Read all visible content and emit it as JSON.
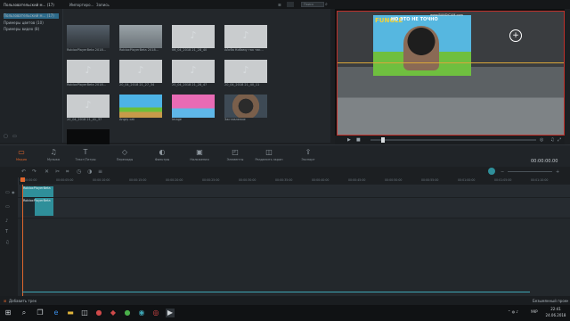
{
  "top": {
    "project_menu": "Пользовательский м... (17)",
    "import_label": "Импортиро...",
    "export_label": "Запись",
    "search_placeholder": "Поиск"
  },
  "library": {
    "items": [
      {
        "label": "Пользовательский м... (17)"
      },
      {
        "label": "Примеры цветов (10)"
      },
      {
        "label": "Примеры видео (8)"
      }
    ]
  },
  "media": {
    "items": [
      {
        "label": "RobloxPlayerBeta 2018...",
        "kind": "video-dark"
      },
      {
        "label": "RobloxPlayerBeta 2018...",
        "kind": "video-gray"
      },
      {
        "label": "06_04_2018 21_28_40",
        "kind": "audio"
      },
      {
        "label": "Айсба Кобаму так так...",
        "kind": "audio"
      },
      {
        "label": "RobloxPlayerBeta 2018...",
        "kind": "audio"
      },
      {
        "label": "20_04_2018 21_27_34",
        "kind": "audio"
      },
      {
        "label": "20_04_2018 21_28_47",
        "kind": "audio"
      },
      {
        "label": "20_04_2018 21_40_11",
        "kind": "audio"
      },
      {
        "label": "20_04_2018 21_41_37",
        "kind": "audio"
      },
      {
        "label": "Angry cat",
        "kind": "game"
      },
      {
        "label": "Image",
        "kind": "pink"
      },
      {
        "label": "Заставление",
        "kind": "person"
      },
      {
        "label": "",
        "kind": "dark"
      }
    ]
  },
  "preview": {
    "banner_left": "FUNGLE",
    "overlay_text": "НО ЭТО НЕ ТОЧНО",
    "watermark": "www.BANDICAM.com",
    "timecode": "00:00:00.00"
  },
  "toolbar": {
    "items": [
      {
        "label": "Медиа",
        "icon": "folder-icon"
      },
      {
        "label": "Музыка",
        "icon": "music-icon"
      },
      {
        "label": "Текст/Титры",
        "icon": "text-icon"
      },
      {
        "label": "Переходы",
        "icon": "transition-icon"
      },
      {
        "label": "Фильтры",
        "icon": "filter-icon"
      },
      {
        "label": "Наложения",
        "icon": "overlay-icon"
      },
      {
        "label": "Элементы",
        "icon": "elements-icon"
      },
      {
        "label": "Разделить экран",
        "icon": "split-icon"
      },
      {
        "label": "Экспорт",
        "icon": "export-icon"
      }
    ]
  },
  "ruler": {
    "ticks": [
      "00:00:00:00",
      "00:00:05:00",
      "00:00:10:00",
      "00:00:15:00",
      "00:00:20:00",
      "00:00:25:00",
      "00:00:30:00",
      "00:00:35:00",
      "00:00:40:00",
      "00:00:45:00",
      "00:00:50:00",
      "00:00:55:00",
      "00:01:00:00",
      "00:01:05:00",
      "00:01:10:00"
    ]
  },
  "timeline": {
    "clip_video_label": "RobloxPlayerBeta",
    "clip_audio_label": "RobloxPlayerBeta"
  },
  "status": {
    "left": "Добавить трек",
    "right": "Безымянный проект"
  },
  "taskbar": {
    "lang": "УКР",
    "time": "22:41",
    "date": "24.06.2018"
  },
  "colors": {
    "accent": "#e0662c",
    "selection": "#2d6a8a",
    "playhead": "#e0662c",
    "clip_teal": "#2f8f9a"
  }
}
